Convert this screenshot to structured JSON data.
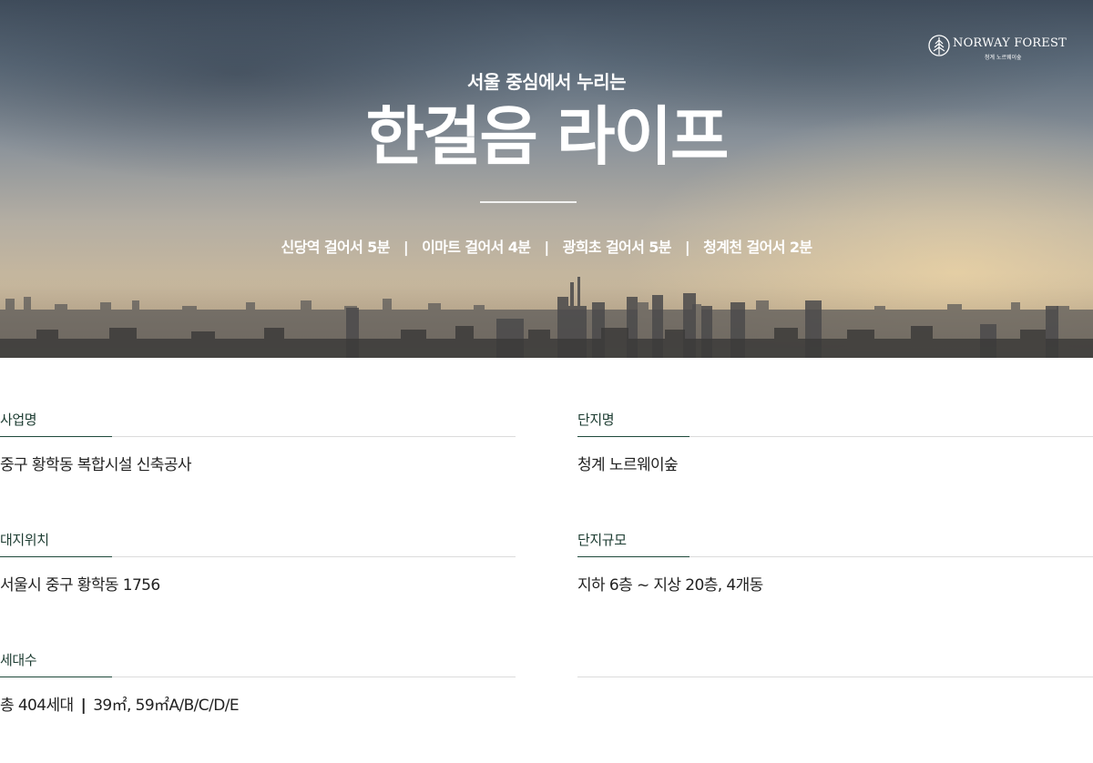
{
  "brand": {
    "name": "NORWAY FOREST",
    "sub": "청계 노르웨이숲",
    "icon": "pine-tree-icon"
  },
  "hero": {
    "subtitle": "서울 중심에서 누리는",
    "title": "한걸음 라이프",
    "features": [
      "신당역 걸어서 5분",
      "이마트 걸어서 4분",
      "광희초 걸어서 5분",
      "청계천 걸어서 2분"
    ],
    "separator": "|"
  },
  "info": {
    "project_name": {
      "label": "사업명",
      "value": "중구 황학동 복합시설 신축공사"
    },
    "complex_name": {
      "label": "단지명",
      "value": "청계 노르웨이숲"
    },
    "location": {
      "label": "대지위치",
      "value": "서울시 중구 황학동 1756"
    },
    "scale": {
      "label": "단지규모",
      "value": "지하 6층 ~ 지상 20층, 4개동"
    },
    "households": {
      "label": "세대수",
      "value_total": "총 404세대",
      "separator": "|",
      "value_types": "39㎡, 59㎡A/B/C/D/E"
    }
  },
  "colors": {
    "accent_green": "#1f4a3b",
    "label_green": "#1b3b30",
    "divider_gray": "#dcdcdc"
  }
}
